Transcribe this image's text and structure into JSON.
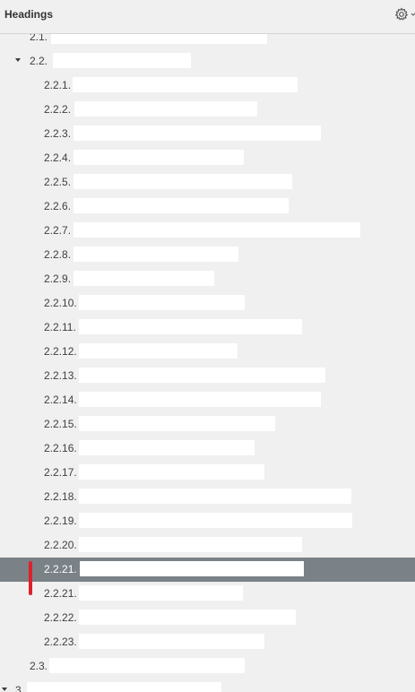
{
  "header": {
    "title": "Headings",
    "gear_icon": "gear-icon"
  },
  "headings": [
    {
      "num": "2.1.",
      "level": 1,
      "expanded": null,
      "selected": false
    },
    {
      "num": "2.2.",
      "level": 1,
      "expanded": true,
      "selected": false
    },
    {
      "num": "2.2.1.",
      "level": 2,
      "selected": false
    },
    {
      "num": "2.2.2.",
      "level": 2,
      "selected": false
    },
    {
      "num": "2.2.3.",
      "level": 2,
      "selected": false
    },
    {
      "num": "2.2.4.",
      "level": 2,
      "selected": false
    },
    {
      "num": "2.2.5.",
      "level": 2,
      "selected": false
    },
    {
      "num": "2.2.6.",
      "level": 2,
      "selected": false
    },
    {
      "num": "2.2.7.",
      "level": 2,
      "selected": false
    },
    {
      "num": "2.2.8.",
      "level": 2,
      "selected": false
    },
    {
      "num": "2.2.9.",
      "level": 2,
      "selected": false
    },
    {
      "num": "2.2.10.",
      "level": 2,
      "selected": false
    },
    {
      "num": "2.2.11.",
      "level": 2,
      "selected": false
    },
    {
      "num": "2.2.12.",
      "level": 2,
      "selected": false
    },
    {
      "num": "2.2.13.",
      "level": 2,
      "selected": false
    },
    {
      "num": "2.2.14.",
      "level": 2,
      "selected": false
    },
    {
      "num": "2.2.15.",
      "level": 2,
      "selected": false
    },
    {
      "num": "2.2.16.",
      "level": 2,
      "selected": false
    },
    {
      "num": "2.2.17.",
      "level": 2,
      "selected": false
    },
    {
      "num": "2.2.18.",
      "level": 2,
      "selected": false
    },
    {
      "num": "2.2.19.",
      "level": 2,
      "selected": false
    },
    {
      "num": "2.2.20.",
      "level": 2,
      "selected": false
    },
    {
      "num": "2.2.21.",
      "level": 2,
      "selected": true
    },
    {
      "num": "2.2.21.",
      "level": 2,
      "selected": false
    },
    {
      "num": "2.2.22.",
      "level": 2,
      "selected": false
    },
    {
      "num": "2.2.23.",
      "level": 2,
      "selected": false
    },
    {
      "num": "2.3.",
      "level": 1,
      "expanded": null,
      "selected": false
    },
    {
      "num": "3.",
      "level": 0,
      "expanded": true,
      "selected": false
    }
  ],
  "colors": {
    "selected_row": "#7a8187",
    "drag_marker": "#e0202a",
    "redacted_text": "#ffffff"
  }
}
